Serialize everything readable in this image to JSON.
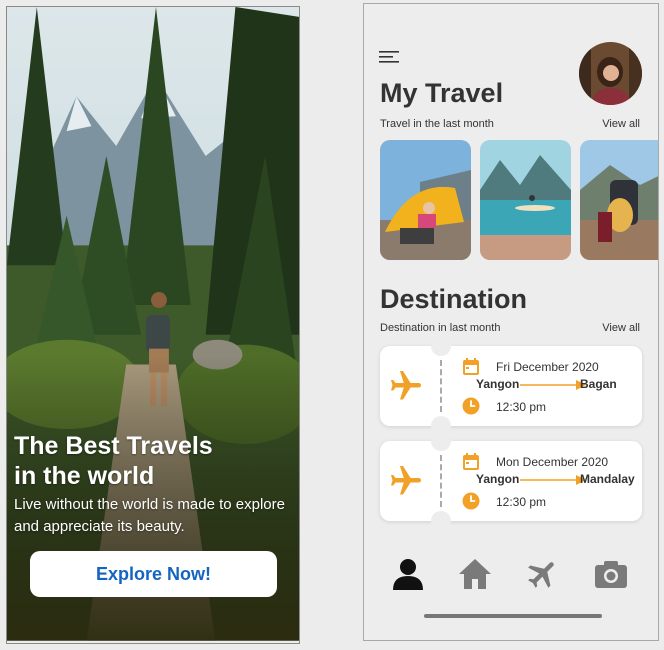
{
  "intro": {
    "title": "The Best Travels\nin the world",
    "subtitle": "Live without the world is made to explore and appreciate its beauty.",
    "button_label": "Explore Now!"
  },
  "home": {
    "title": "My Travel",
    "subtitle": "Travel in the last month",
    "view_all": "View all",
    "photos": [
      {
        "name": "tent-camping-photo"
      },
      {
        "name": "lake-kayak-photo"
      },
      {
        "name": "hiker-with-dog-photo"
      }
    ],
    "destination": {
      "title": "Destination",
      "subtitle": "Destination in last month",
      "view_all": "View all"
    },
    "tickets": [
      {
        "date": "Fri December 2020",
        "from": "Yangon",
        "to": "Bagan",
        "time": "12:30 pm"
      },
      {
        "date": "Mon December 2020",
        "from": "Yangon",
        "to": "Mandalay",
        "time": "12:30 pm"
      }
    ],
    "nav": [
      {
        "icon": "person-icon",
        "active": true
      },
      {
        "icon": "home-icon",
        "active": false
      },
      {
        "icon": "airplane-icon",
        "active": false
      },
      {
        "icon": "camera-icon",
        "active": false
      }
    ]
  },
  "colors": {
    "accent": "#f2a127",
    "button_text": "#1565c0",
    "nav_active": "#111111",
    "nav_inactive": "#7a7a7a"
  }
}
